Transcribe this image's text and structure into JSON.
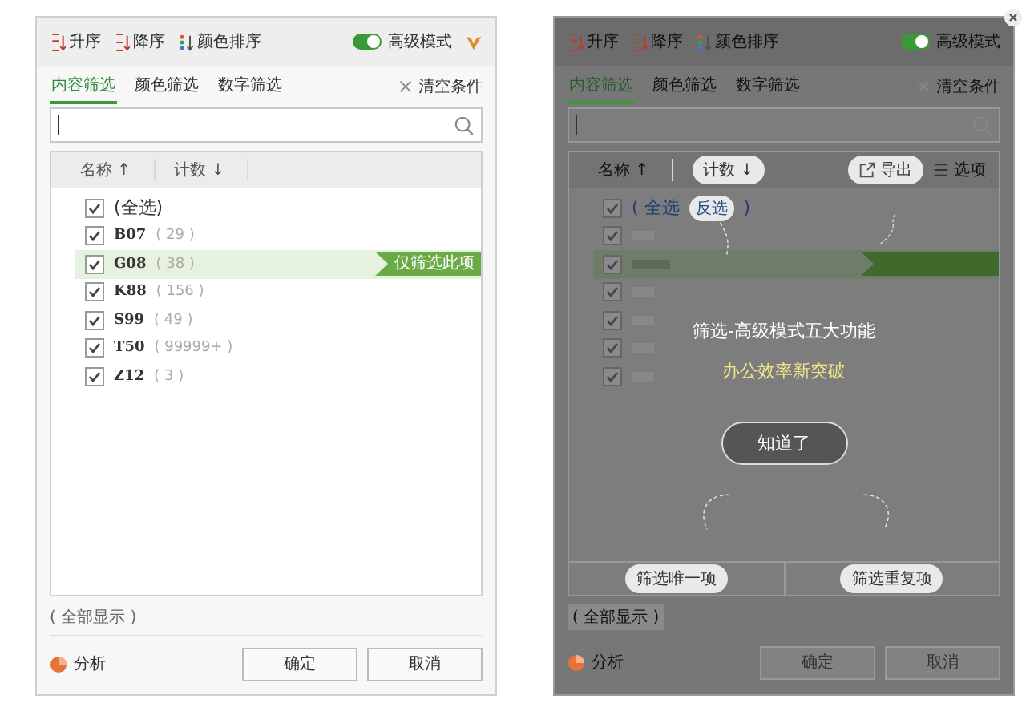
{
  "filter_panel": {
    "toolbar": [
      {
        "kind": "asc",
        "label": "升序"
      },
      {
        "kind": "desc",
        "label": "降序"
      },
      {
        "kind": "color",
        "label": "颜色排序"
      }
    ],
    "advanced_toggle": {
      "label": "高级模式",
      "on": true
    },
    "tabs": [
      {
        "label": "内容筛选",
        "selected": true
      },
      {
        "label": "颜色筛选",
        "selected": false
      },
      {
        "label": "数字筛选",
        "selected": false
      }
    ],
    "clear_button": "清空条件",
    "columns": [
      "名称 ↑",
      "计数 ↓"
    ],
    "items": [
      {
        "label": "(全选)",
        "checked": true,
        "highlighted": false
      },
      {
        "label": "B07",
        "count": "( 29 )",
        "checked": true,
        "highlighted": false
      },
      {
        "label": "G08",
        "count": "( 38 )",
        "checked": true,
        "highlighted": true,
        "flag": "仅筛选此项"
      },
      {
        "label": "K88",
        "count": "( 156 )",
        "checked": true,
        "highlighted": false
      },
      {
        "label": "S99",
        "count": "( 49 )",
        "checked": true,
        "highlighted": false
      },
      {
        "label": "T50",
        "count": "( 99999+ )",
        "checked": true,
        "highlighted": false
      },
      {
        "label": "Z12",
        "count": "( 3 )",
        "checked": true,
        "highlighted": false
      }
    ],
    "show_all": "( 全部显示 )",
    "analyze": "分析",
    "buttons": [
      "确定",
      "取消"
    ]
  },
  "tutorial_panel": {
    "toolbar": [
      {
        "kind": "asc",
        "label": "升序"
      },
      {
        "kind": "desc",
        "label": "降序"
      },
      {
        "kind": "color",
        "label": "颜色排序"
      }
    ],
    "advanced_toggle": {
      "label": "高级模式",
      "on": true
    },
    "tabs": [
      {
        "label": "内容筛选",
        "selected": true
      },
      {
        "label": "颜色筛选",
        "selected": false
      },
      {
        "label": "数字筛选",
        "selected": false
      }
    ],
    "clear_button": "清空条件",
    "name_column": "名称 ↑",
    "count_callout": "计数 ↓",
    "export_callout": "导出",
    "options_label": "选项",
    "select_all": {
      "label": "( 全选",
      "callout": "反选",
      "closing": ")",
      "checked": true
    },
    "blurred_rows": [
      {
        "checked": true,
        "highlighted": false
      },
      {
        "checked": true,
        "highlighted": true
      },
      {
        "checked": true,
        "highlighted": false
      },
      {
        "checked": true,
        "highlighted": false
      },
      {
        "checked": true,
        "highlighted": false
      },
      {
        "checked": true,
        "highlighted": false
      }
    ],
    "headline": "筛选-高级模式五大功能",
    "subline": "办公效率新突破",
    "got_it_button": "知道了",
    "bottom_callouts": [
      "筛选唯一项",
      "筛选重复项"
    ],
    "show_all": "( 全部显示 )",
    "analyze": "分析",
    "buttons": [
      "确定",
      "取消"
    ]
  }
}
